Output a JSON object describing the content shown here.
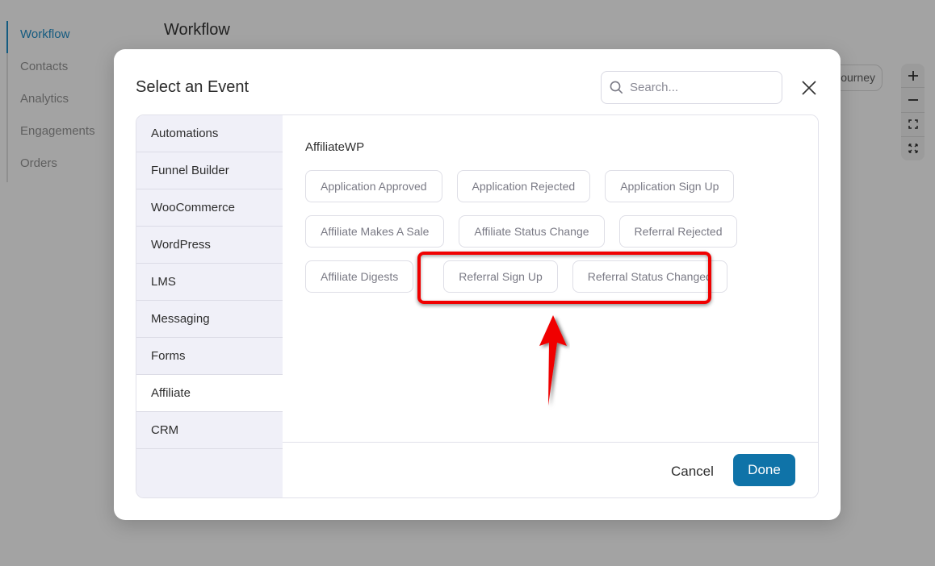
{
  "background": {
    "nav": [
      {
        "label": "Workflow",
        "active": true
      },
      {
        "label": "Contacts",
        "active": false
      },
      {
        "label": "Analytics",
        "active": false
      },
      {
        "label": "Engagements",
        "active": false
      },
      {
        "label": "Orders",
        "active": false
      }
    ],
    "page_title": "Workflow",
    "journey_button_label": "ourney",
    "zoom_controls": {
      "zoom_in": "+",
      "zoom_out": "−"
    }
  },
  "modal": {
    "title": "Select an Event",
    "search": {
      "placeholder": "Search...",
      "value": ""
    },
    "categories": [
      {
        "label": "Automations",
        "active": false
      },
      {
        "label": "Funnel Builder",
        "active": false
      },
      {
        "label": "WooCommerce",
        "active": false
      },
      {
        "label": "WordPress",
        "active": false
      },
      {
        "label": "LMS",
        "active": false
      },
      {
        "label": "Messaging",
        "active": false
      },
      {
        "label": "Forms",
        "active": false
      },
      {
        "label": "Affiliate",
        "active": true
      },
      {
        "label": "CRM",
        "active": false
      }
    ],
    "group_title": "AffiliateWP",
    "events": [
      [
        "Application Approved",
        "Application Rejected",
        "Application Sign Up"
      ],
      [
        "Affiliate Makes A Sale",
        "Affiliate Status Change",
        "Referral Rejected"
      ],
      [
        "Affiliate Digests",
        "Referral Sign Up",
        "Referral Status Changed"
      ]
    ],
    "highlighted_events": [
      "Referral Sign Up",
      "Referral Status Changed"
    ],
    "footer": {
      "cancel_label": "Cancel",
      "done_label": "Done"
    }
  },
  "colors": {
    "accent": "#0f73a8",
    "highlight": "#f00000",
    "active_nav": "#145b80"
  }
}
